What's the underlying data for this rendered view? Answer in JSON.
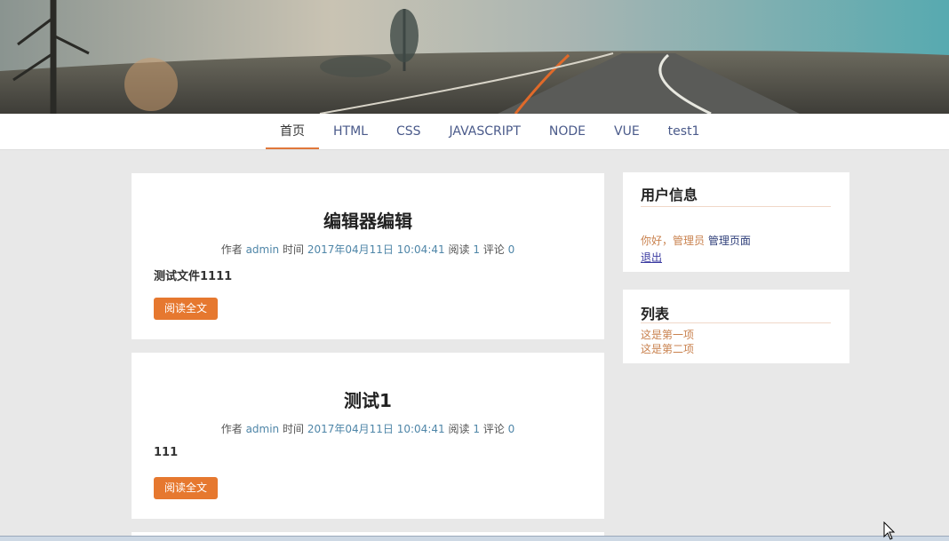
{
  "nav": {
    "items": [
      "首页",
      "HTML",
      "CSS",
      "JAVASCRIPT",
      "NODE",
      "VUE",
      "test1"
    ],
    "active_index": 0
  },
  "articles": [
    {
      "title": "编辑器编辑",
      "meta": {
        "author_label": "作者",
        "author": "admin",
        "time_label": "时间",
        "time": "2017年04月11日 10:04:41",
        "read_label": "阅读",
        "reads": "1",
        "comment_label": "评论",
        "comments": "0"
      },
      "excerpt": "测试文件1111",
      "button": "阅读全文"
    },
    {
      "title": "测试1",
      "meta": {
        "author_label": "作者",
        "author": "admin",
        "time_label": "时间",
        "time": "2017年04月11日 10:04:41",
        "read_label": "阅读",
        "reads": "1",
        "comment_label": "评论",
        "comments": "0"
      },
      "excerpt": "111",
      "button": "阅读全文"
    }
  ],
  "sidebar": {
    "user": {
      "heading": "用户信息",
      "greeting": "你好，管理员",
      "admin_link": "管理页面",
      "logout": "退出"
    },
    "list": {
      "heading": "列表",
      "items": [
        "这是第一项",
        "这是第二项"
      ]
    }
  },
  "colors": {
    "accent": "#e6782f",
    "link": "#4f86a8",
    "nav_text": "#4a5a8a",
    "background": "#e8e8e8"
  }
}
